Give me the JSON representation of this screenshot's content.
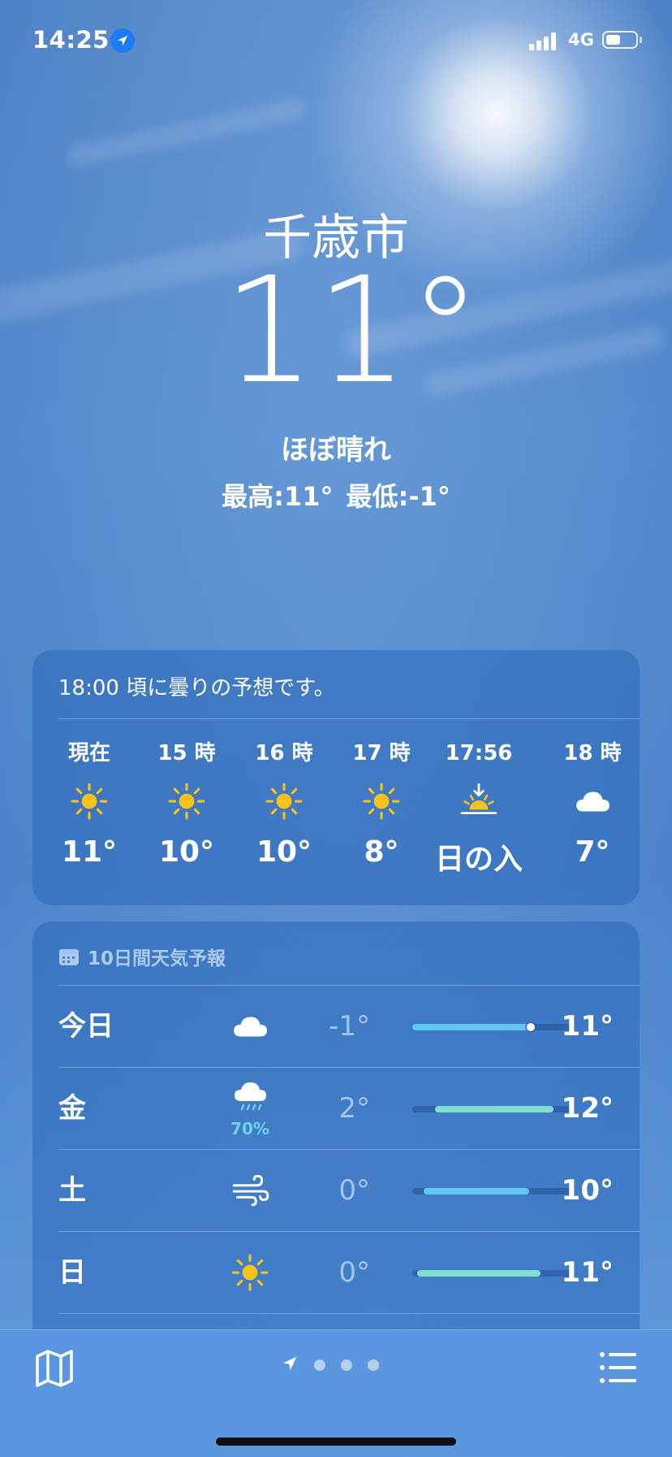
{
  "status_bar": {
    "time": "14:25",
    "network": "4G",
    "signal_bars": 4,
    "battery_level": 0.4,
    "location_icon": "location-arrow-icon"
  },
  "location": {
    "city": "千歳市",
    "temperature": "11°",
    "condition": "ほぼ晴れ",
    "high": "最高:11°",
    "low": "最低:-1°"
  },
  "hourly": {
    "summary": "18:00 頃に曇りの予想です。",
    "items": [
      {
        "label": "現在",
        "icon": "sun-icon",
        "value": "11°"
      },
      {
        "label": "15 時",
        "icon": "sun-icon",
        "value": "10°"
      },
      {
        "label": "16 時",
        "icon": "sun-icon",
        "value": "10°"
      },
      {
        "label": "17 時",
        "icon": "sun-icon",
        "value": "8°"
      },
      {
        "label": "17:56",
        "icon": "sunset-icon",
        "value": "日の入"
      },
      {
        "label": "18 時",
        "icon": "cloud-icon",
        "value": "7°"
      }
    ]
  },
  "daily": {
    "title": "10日間天気予報",
    "items": [
      {
        "day": "今日",
        "icon": "cloud-icon",
        "precip": "",
        "low": "-1°",
        "high": "11°"
      },
      {
        "day": "金",
        "icon": "cloud-rain-icon",
        "precip": "70%",
        "low": "2°",
        "high": "12°"
      },
      {
        "day": "土",
        "icon": "wind-icon",
        "precip": "",
        "low": "0°",
        "high": "10°"
      },
      {
        "day": "日",
        "icon": "sun-icon",
        "precip": "",
        "low": "0°",
        "high": "11°"
      }
    ]
  },
  "toolbar": {
    "map_icon": "map-icon",
    "list_icon": "list-icon",
    "page_count": 4,
    "current_page": 0
  },
  "colors": {
    "sun": "#f7c21a",
    "rain_bar": "#6fd0f6",
    "temp_bar_cool": "#5fc6f0",
    "temp_bar_mild": "#7fe0d0",
    "location_badge": "#1e7cf2"
  }
}
